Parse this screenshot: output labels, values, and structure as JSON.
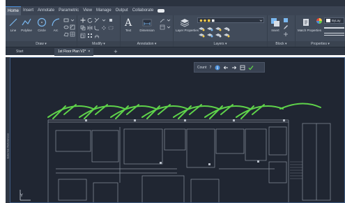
{
  "ribbon_tabs": [
    "Home",
    "Insert",
    "Annotate",
    "Parametric",
    "View",
    "Manage",
    "Output",
    "Collaborate"
  ],
  "active_tab": "Home",
  "panels": {
    "draw": {
      "title": "Draw ▾",
      "tools": [
        "Line",
        "Polyline",
        "Circle",
        "Arc"
      ]
    },
    "modify": {
      "title": "Modify ▾"
    },
    "annotation": {
      "title": "Annotation ▾",
      "tools": [
        "Text",
        "Dimension"
      ]
    },
    "layers": {
      "title": "Layers ▾",
      "tools": [
        "Layer Properties"
      ]
    },
    "block": {
      "title": "Block ▾",
      "tools": [
        "Insert"
      ]
    },
    "properties": {
      "title": "Properties ▾",
      "tools": [
        "Match Properties"
      ],
      "layer_value": "ByLay"
    }
  },
  "file_tabs": [
    {
      "label": "Start",
      "active": false
    },
    {
      "label": "1st Floor Plan V2*",
      "active": true,
      "close": "×"
    }
  ],
  "new_tab_symbol": "+",
  "side_palette_label": "External References",
  "count_toolbar": {
    "label": "Count",
    "value": "7"
  },
  "ucs_label": "Y",
  "colors": {
    "canvas": "#202632",
    "ribbon": "#414b5a",
    "highlight_green": "#5fd34a",
    "accent_blue": "#4a8ed8"
  },
  "count_result": 7
}
